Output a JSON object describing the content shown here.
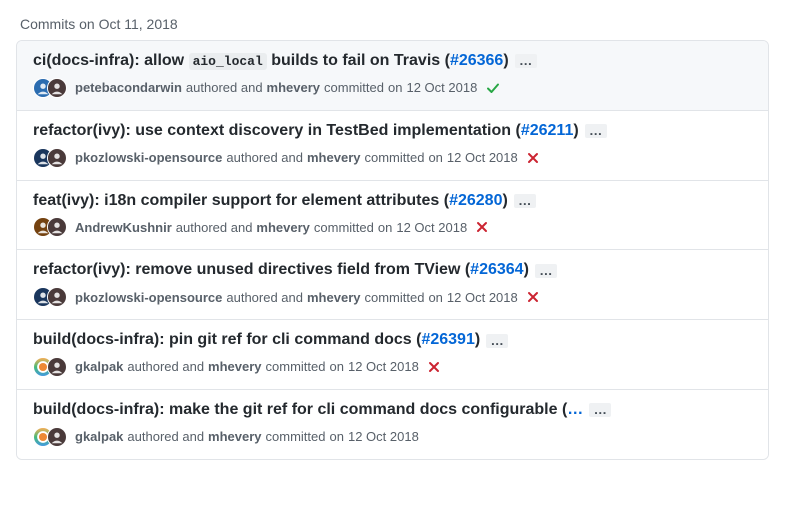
{
  "date_header": "Commits on Oct 11, 2018",
  "meta_strings": {
    "authored_and": "authored and",
    "committed": "committed",
    "on": "on"
  },
  "avatar_colors": {
    "petebacondarwin": "#2b6cb0",
    "mhevery": "#4a3a3a",
    "pkozlowski-opensource": "#1a365d",
    "AndrewKushnir": "#744210",
    "gkalpak": "#38a169"
  },
  "commits": [
    {
      "selected": true,
      "title_front": "ci(docs-infra): allow ",
      "code_frag": "aio_local",
      "title_back": " builds to fail on Travis (",
      "pr": "#26366",
      "title_close": ")",
      "author": "petebacondarwin",
      "committer": "mhevery",
      "date": "12 Oct 2018",
      "status": "success"
    },
    {
      "selected": false,
      "title_front": "refactor(ivy): use context discovery in TestBed implementation (",
      "code_frag": "",
      "title_back": "",
      "pr": "#26211",
      "title_close": ")",
      "author": "pkozlowski-opensource",
      "committer": "mhevery",
      "date": "12 Oct 2018",
      "status": "failure"
    },
    {
      "selected": false,
      "title_front": "feat(ivy): i18n compiler support for element attributes (",
      "code_frag": "",
      "title_back": "",
      "pr": "#26280",
      "title_close": ")",
      "author": "AndrewKushnir",
      "committer": "mhevery",
      "date": "12 Oct 2018",
      "status": "failure"
    },
    {
      "selected": false,
      "title_front": "refactor(ivy): remove unused directives field from TView (",
      "code_frag": "",
      "title_back": "",
      "pr": "#26364",
      "title_close": ")",
      "author": "pkozlowski-opensource",
      "committer": "mhevery",
      "date": "12 Oct 2018",
      "status": "failure"
    },
    {
      "selected": false,
      "title_front": "build(docs-infra): pin git ref for cli command docs (",
      "code_frag": "",
      "title_back": "",
      "pr": "#26391",
      "title_close": ")",
      "author": "gkalpak",
      "committer": "mhevery",
      "date": "12 Oct 2018",
      "status": "failure"
    },
    {
      "selected": false,
      "title_front": "build(docs-infra): make the git ref for cli command docs configurable (",
      "code_frag": "",
      "title_back": "",
      "pr": "…",
      "title_close": "",
      "author": "gkalpak",
      "committer": "mhevery",
      "date": "12 Oct 2018",
      "status": "none"
    }
  ]
}
